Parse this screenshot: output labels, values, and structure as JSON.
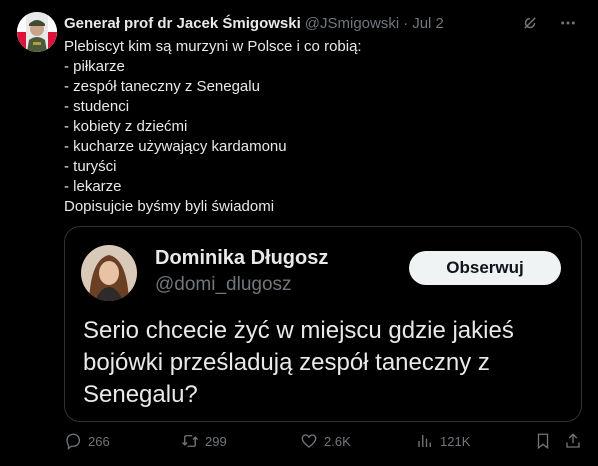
{
  "tweet": {
    "author_name": "Generał prof dr Jacek Śmigowski",
    "author_handle": "@JSmigowski",
    "separator": "·",
    "date": "Jul 2",
    "lines": [
      "Plebiscyt kim są murzyni w Polsce i co robią:",
      "- piłkarze",
      "- zespół taneczny z Senegalu",
      "- studenci",
      "- kobiety z dziećmi",
      "- kucharze używający kardamonu",
      "- turyści",
      "- lekarze",
      "Dopisujcie byśmy byli świadomi"
    ]
  },
  "quote": {
    "author_name": "Dominika Długosz",
    "author_handle": "@domi_dlugosz",
    "follow_label": "Obserwuj",
    "text": "Serio chcecie żyć w miejscu gdzie jakieś bojówki prześladują zespół taneczny z Senegalu?"
  },
  "actions": {
    "replies": "266",
    "retweets": "299",
    "likes": "2.6K",
    "views": "121K"
  },
  "icons": {
    "header": [
      "grok-icon",
      "more-icon"
    ],
    "actions": [
      "reply-icon",
      "retweet-icon",
      "like-icon",
      "views-icon",
      "bookmark-icon",
      "share-icon"
    ]
  },
  "colors": {
    "background": "#000000",
    "text_primary": "#e7e9ea",
    "text_secondary": "#71767b",
    "border": "#2f3336",
    "follow_button_bg": "#eff3f4"
  }
}
